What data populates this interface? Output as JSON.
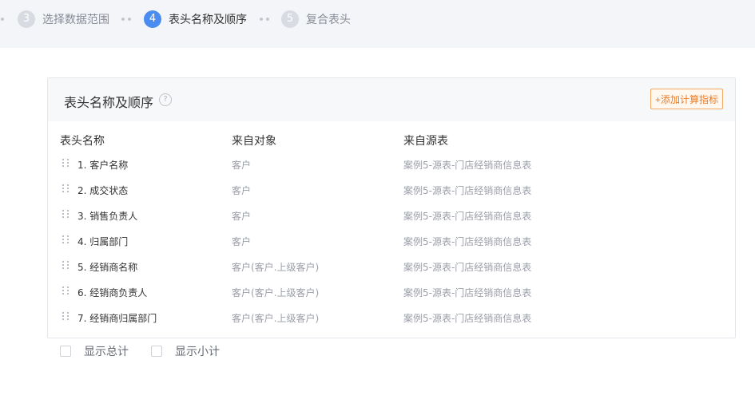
{
  "steps": [
    {
      "number": "3",
      "label": "选择数据范围"
    },
    {
      "number": "4",
      "label": "表头名称及顺序"
    },
    {
      "number": "5",
      "label": "复合表头"
    }
  ],
  "panel": {
    "title": "表头名称及顺序",
    "help_glyph": "?",
    "add_button_label": "+添加计算指标",
    "columns": [
      "表头名称",
      "来自对象",
      "来自源表"
    ],
    "rows": [
      {
        "name": "1. 客户名称",
        "object": "客户",
        "source": "案例5-源表-门店经销商信息表"
      },
      {
        "name": "2. 成交状态",
        "object": "客户",
        "source": "案例5-源表-门店经销商信息表"
      },
      {
        "name": "3. 销售负责人",
        "object": "客户",
        "source": "案例5-源表-门店经销商信息表"
      },
      {
        "name": "4. 归属部门",
        "object": "客户",
        "source": "案例5-源表-门店经销商信息表"
      },
      {
        "name": "5. 经销商名称",
        "object": "客户(客户.上级客户)",
        "source": "案例5-源表-门店经销商信息表"
      },
      {
        "name": "6. 经销商负责人",
        "object": "客户(客户.上级客户)",
        "source": "案例5-源表-门店经销商信息表"
      },
      {
        "name": "7. 经销商归属部门",
        "object": "客户(客户.上级客户)",
        "source": "案例5-源表-门店经销商信息表"
      }
    ]
  },
  "options": {
    "show_total_label": "显示总计",
    "show_subtotal_label": "显示小计"
  },
  "icons": {
    "help": "help-circle-icon",
    "drag": "drag-handle-icon"
  },
  "colors": {
    "accent_blue": "#4a8cf0",
    "accent_orange": "#f07a1e"
  }
}
